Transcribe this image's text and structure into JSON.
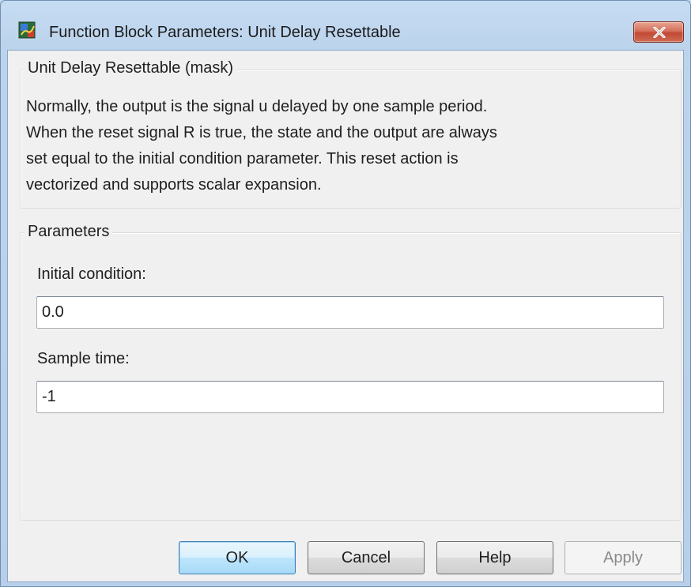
{
  "window": {
    "title": "Function Block Parameters: Unit Delay Resettable",
    "close_icon": "close-icon",
    "app_icon": "simulink-block-icon"
  },
  "mask_group": {
    "legend": "Unit Delay Resettable (mask)",
    "description_lines": [
      "Normally, the output is the signal u delayed by one sample period.",
      "When the reset signal R is true, the state and the output are always",
      "set equal to the initial condition parameter.  This reset action is",
      "vectorized and supports scalar expansion."
    ]
  },
  "parameters_group": {
    "legend": "Parameters",
    "initial_condition": {
      "label": "Initial condition:",
      "value": "0.0"
    },
    "sample_time": {
      "label": "Sample time:",
      "value": "-1"
    }
  },
  "buttons": {
    "ok": "OK",
    "cancel": "Cancel",
    "help": "Help",
    "apply": "Apply",
    "apply_enabled": false
  },
  "colors": {
    "close_button": "#c24a35",
    "default_button_border": "#3c7fb1",
    "dialog_background": "#f0f0f0"
  }
}
